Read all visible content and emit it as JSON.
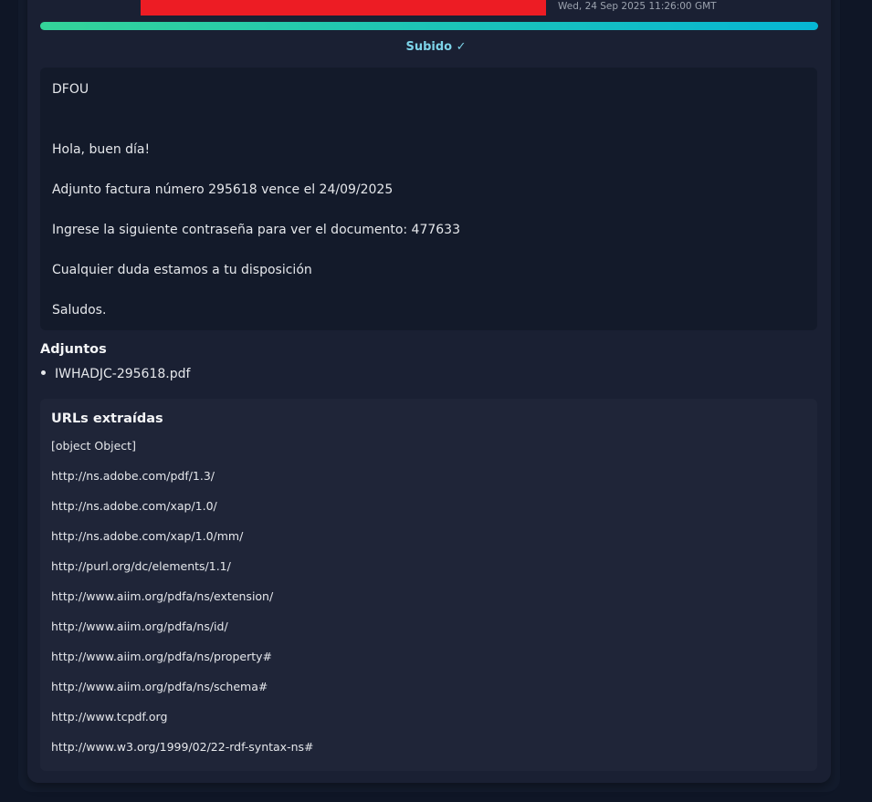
{
  "header": {
    "timestamp": "Wed, 24 Sep 2025 11:26:00 GMT",
    "status": "Subido ✓",
    "progress_percent": 100
  },
  "message": {
    "lines": [
      "DFOU",
      "Hola, buen día!",
      "Adjunto factura número 295618 vence el 24/09/2025",
      "Ingrese la siguiente contraseña para ver el documento: 477633",
      "Cualquier duda estamos a tu disposición",
      "Saludos."
    ]
  },
  "attachments": {
    "title": "Adjuntos",
    "items": [
      "IWHADJC-295618.pdf"
    ]
  },
  "urls": {
    "title": "URLs extraídas",
    "items": [
      "[object Object]",
      "http://ns.adobe.com/pdf/1.3/",
      "http://ns.adobe.com/xap/1.0/",
      "http://ns.adobe.com/xap/1.0/mm/",
      "http://purl.org/dc/elements/1.1/",
      "http://www.aiim.org/pdfa/ns/extension/",
      "http://www.aiim.org/pdfa/ns/id/",
      "http://www.aiim.org/pdfa/ns/property#",
      "http://www.aiim.org/pdfa/ns/schema#",
      "http://www.tcpdf.org",
      "http://www.w3.org/1999/02/22-rdf-syntax-ns#"
    ]
  }
}
